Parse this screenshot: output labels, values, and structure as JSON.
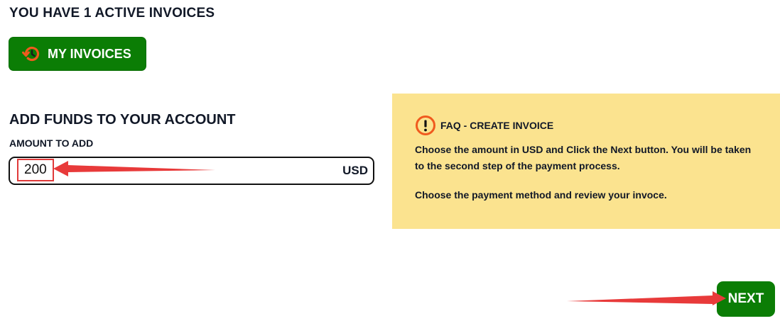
{
  "active": {
    "title": "YOU HAVE 1 ACTIVE INVOICES",
    "button_label": "MY INVOICES",
    "button_icon": "history-icon"
  },
  "funds": {
    "title": "ADD FUNDS TO YOUR ACCOUNT",
    "amount_label": "AMOUNT TO ADD",
    "amount_value": "200",
    "currency": "USD"
  },
  "faq": {
    "icon": "exclamation-icon",
    "title": "FAQ - CREATE INVOICE",
    "paragraphs": [
      "Choose the amount in USD and Click the Next button. You will be taken to the second step of the payment process.",
      "Choose the payment method and review your invoce."
    ]
  },
  "next_label": "NEXT",
  "colors": {
    "button_green": "#0b7d05",
    "faq_background": "#fbe38f",
    "icon_orange": "#f05a1e",
    "annotation_red": "#e83a3a"
  }
}
